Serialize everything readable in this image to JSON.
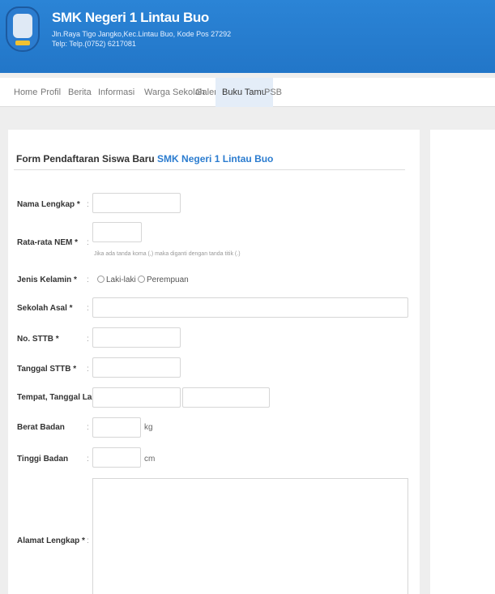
{
  "header": {
    "title": "SMK Negeri 1 Lintau Buo",
    "address": "Jln.Raya Tigo Jangko,Kec.Lintau Buo, Kode Pos 27292",
    "phone": "Telp: Telp.(0752) 6217081"
  },
  "nav": {
    "items": [
      "Home",
      "Profil",
      "Berita",
      "Informasi",
      "Warga Sekolah",
      "Galeri",
      "Buku Tamu",
      "PSB"
    ],
    "active": "Buku Tamu"
  },
  "form": {
    "title_prefix": "Form Pendaftaran Siswa Baru ",
    "title_school": "SMK Negeri 1 Lintau Buo",
    "colon": ":",
    "fields": {
      "nama": "Nama Lengkap *",
      "nem": "Rata-rata NEM *",
      "nem_hint": "Jika ada tanda koma (,) maka diganti dengan tanda titik (.)",
      "jenis": "Jenis Kelamin *",
      "laki": "Laki-laki",
      "perempuan": "Perempuan",
      "sekolah": "Sekolah Asal *",
      "sttb": "No. STTB *",
      "tgl_sttb": "Tanggal STTB *",
      "ttl": "Tempat, Tanggal Lahir *",
      "berat": "Berat Badan",
      "berat_unit": "kg",
      "tinggi": "Tinggi Badan",
      "tinggi_unit": "cm",
      "alamat": "Alamat Lengkap *"
    }
  }
}
